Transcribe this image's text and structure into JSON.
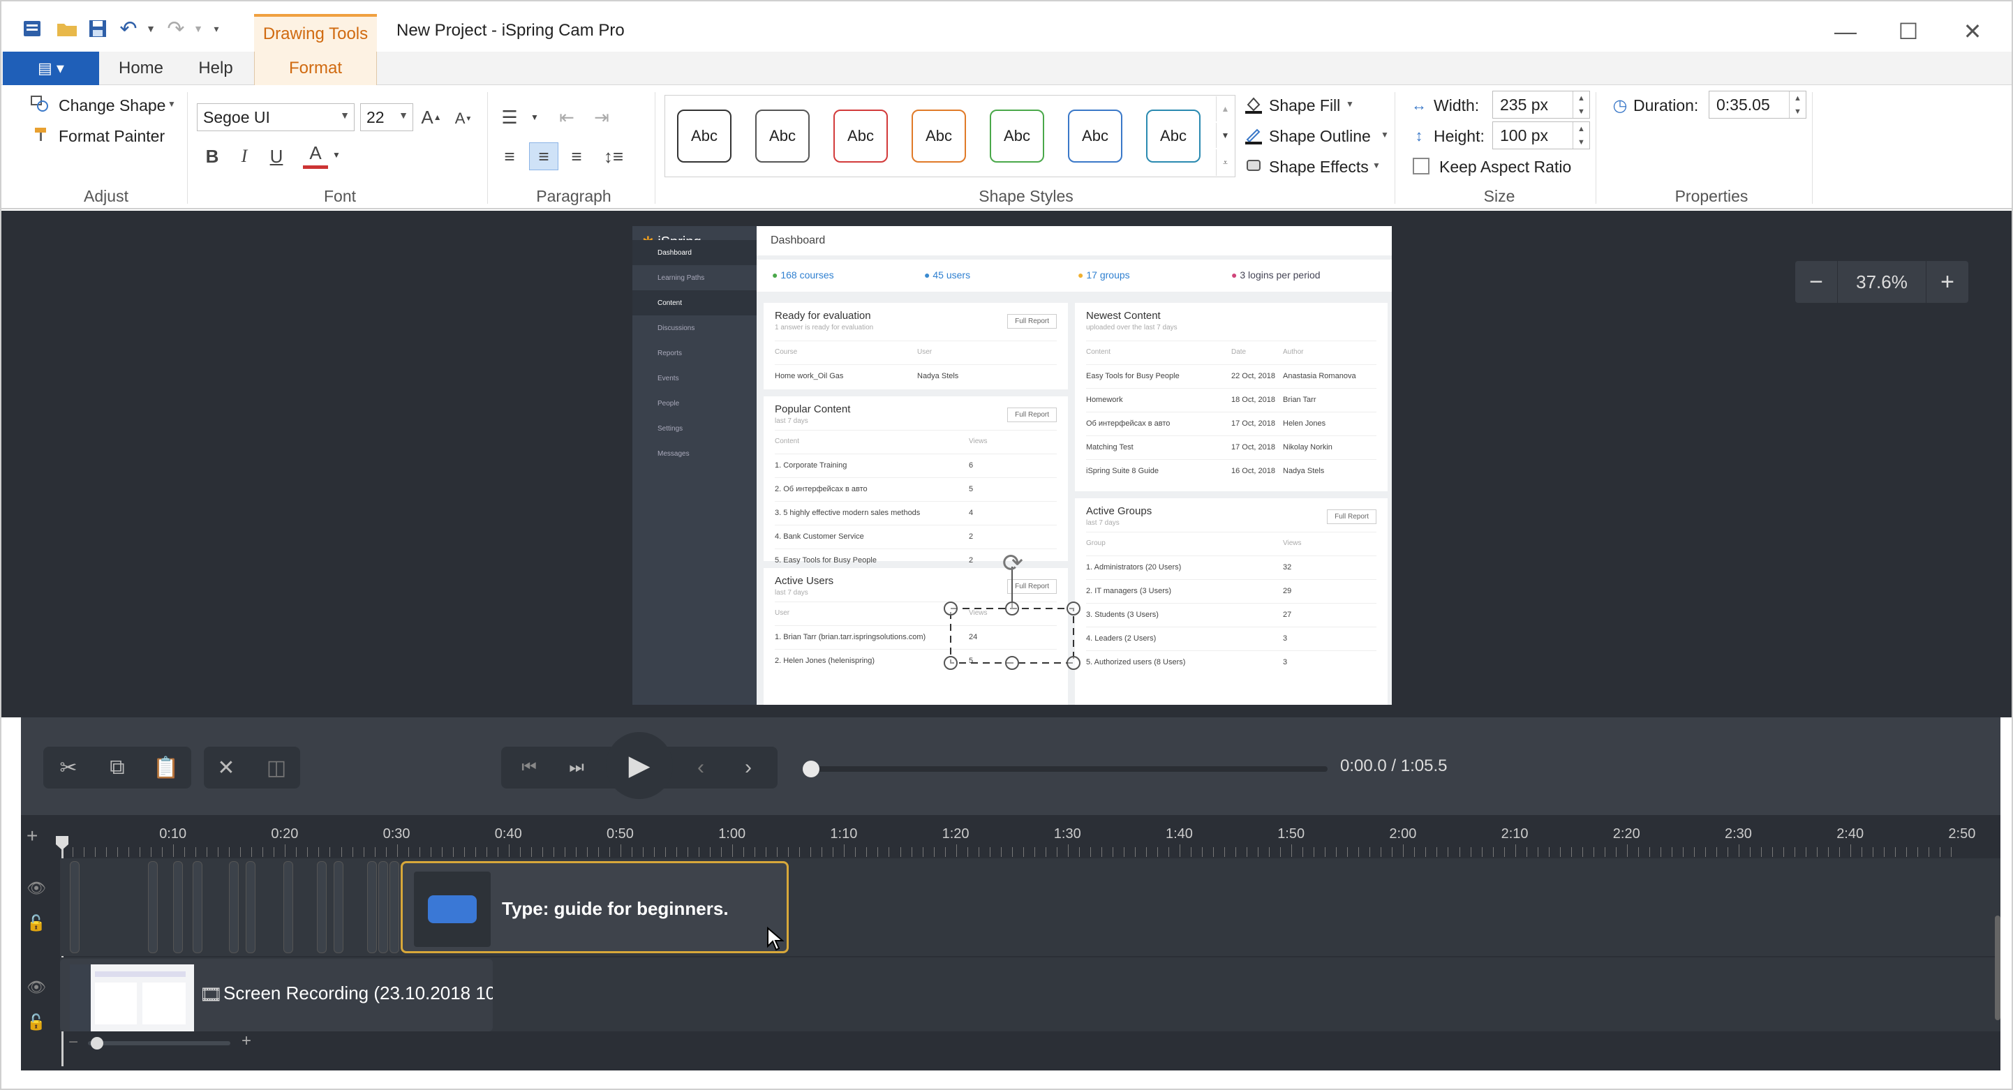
{
  "window": {
    "title": "New Project - iSpring Cam Pro",
    "contextual_tab": "Drawing Tools",
    "controls": [
      "minimize-icon",
      "maximize-icon",
      "close-icon"
    ]
  },
  "tabs": {
    "file_icon": "menu-icon",
    "home": "Home",
    "help": "Help",
    "format": "Format"
  },
  "ribbon": {
    "adjust": {
      "change_shape": "Change Shape",
      "format_painter": "Format Painter",
      "label": "Adjust"
    },
    "font": {
      "family": "Segoe UI",
      "size": "22",
      "label": "Font",
      "bold": "B",
      "italic": "I",
      "underline": "U",
      "color_letter": "A"
    },
    "paragraph": {
      "label": "Paragraph"
    },
    "shape_styles": {
      "label": "Shape Styles",
      "items": [
        {
          "label": "Abc",
          "color": "#222222"
        },
        {
          "label": "Abc",
          "color": "#555555"
        },
        {
          "label": "Abc",
          "color": "#d23a3a"
        },
        {
          "label": "Abc",
          "color": "#e07a28"
        },
        {
          "label": "Abc",
          "color": "#4aa84a"
        },
        {
          "label": "Abc",
          "color": "#3a78c8"
        },
        {
          "label": "Abc",
          "color": "#2a8ab0"
        }
      ],
      "shape_fill": "Shape Fill",
      "shape_outline": "Shape Outline",
      "shape_effects": "Shape Effects"
    },
    "size": {
      "label": "Size",
      "width_label": "Width:",
      "width_value": "235 px",
      "height_label": "Height:",
      "height_value": "100 px",
      "keep_aspect": "Keep Aspect Ratio"
    },
    "properties": {
      "label": "Properties",
      "duration_label": "Duration:",
      "duration_value": "0:35.05"
    }
  },
  "canvas": {
    "zoom": "37.6%",
    "preview": {
      "logo": "iSpring",
      "header": "Dashboard",
      "nav": [
        "Dashboard",
        "Learning Paths",
        "Content",
        "Discussions",
        "Reports",
        "Events",
        "People",
        "Settings",
        "Messages"
      ],
      "stats": [
        {
          "value": "168",
          "label": "courses"
        },
        {
          "value": "45",
          "label": "users"
        },
        {
          "value": "17",
          "label": "groups"
        },
        {
          "value": "3",
          "label": "logins per period"
        }
      ],
      "ready": {
        "title": "Ready for evaluation",
        "subtitle": "1 answer is ready for evaluation",
        "button": "Full Report",
        "cols": [
          "Course",
          "User"
        ],
        "rows": [
          [
            "Home work_Oil Gas",
            "Nadya Stels"
          ]
        ]
      },
      "popular": {
        "title": "Popular Content",
        "subtitle": "last 7 days",
        "button": "Full Report",
        "cols": [
          "Content",
          "Views"
        ],
        "rows": [
          [
            "1. Corporate Training",
            "6"
          ],
          [
            "2. Об интерфейсах в авто",
            "5"
          ],
          [
            "3. 5 highly effective modern sales methods",
            "4"
          ],
          [
            "4. Bank Customer Service",
            "2"
          ],
          [
            "5. Easy Tools for Busy People",
            "2"
          ]
        ]
      },
      "users": {
        "title": "Active Users",
        "subtitle": "last 7 days",
        "button": "Full Report",
        "cols": [
          "User",
          "Views"
        ],
        "rows": [
          [
            "1. Brian Tarr (brian.tarr.ispringsolutions.com)",
            "24"
          ],
          [
            "2. Helen Jones (helenispring)",
            "5"
          ]
        ]
      },
      "newest": {
        "title": "Newest Content",
        "subtitle": "uploaded over the last 7 days",
        "cols": [
          "Content",
          "Date",
          "Author"
        ],
        "rows": [
          [
            "Easy Tools for Busy People",
            "22 Oct, 2018",
            "Anastasia Romanova"
          ],
          [
            "Homework",
            "18 Oct, 2018",
            "Brian Tarr"
          ],
          [
            "Об интерфейсах в авто",
            "17 Oct, 2018",
            "Helen Jones"
          ],
          [
            "Matching Test",
            "17 Oct, 2018",
            "Nikolay Norkin"
          ],
          [
            "iSpring Suite 8 Guide",
            "16 Oct, 2018",
            "Nadya Stels"
          ]
        ]
      },
      "groups": {
        "title": "Active Groups",
        "subtitle": "last 7 days",
        "button": "Full Report",
        "cols": [
          "Group",
          "Views"
        ],
        "rows": [
          [
            "1. Administrators (20 Users)",
            "32"
          ],
          [
            "2. IT managers (3 Users)",
            "29"
          ],
          [
            "3. Students (3 Users)",
            "27"
          ],
          [
            "4. Leaders (2 Users)",
            "3"
          ],
          [
            "5. Authorized users (8 Users)",
            "3"
          ]
        ]
      }
    }
  },
  "player": {
    "time": "0:00.0 / 1:05.5"
  },
  "timeline": {
    "ticks": [
      "0:10",
      "0:20",
      "0:30",
      "0:40",
      "0:50",
      "1:00",
      "1:10",
      "1:20",
      "1:30",
      "1:40",
      "1:50",
      "2:00",
      "2:10",
      "2:20",
      "2:30",
      "2:40",
      "2:50"
    ],
    "clip_text": "Type: guide for beginners.",
    "recording_text": "Screen Recording (23.10.2018 10"
  }
}
